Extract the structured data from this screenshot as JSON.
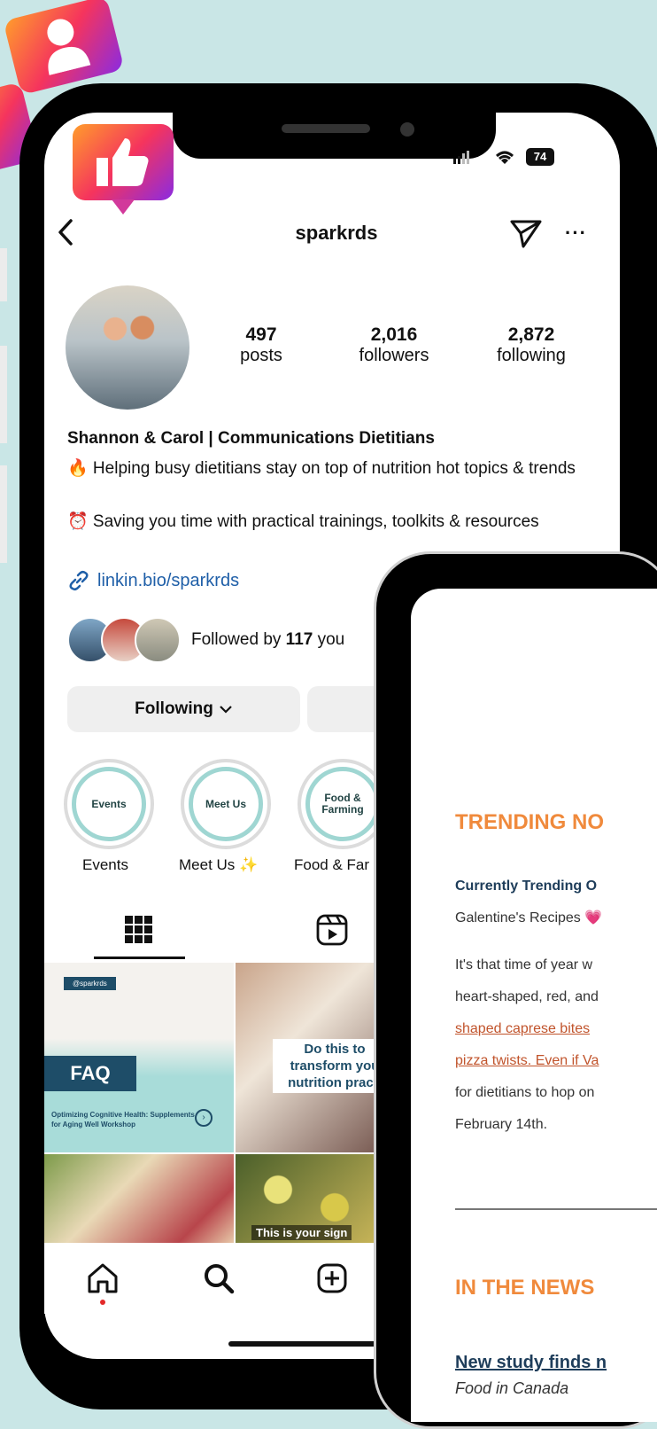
{
  "badges": {
    "user": "user-icon",
    "like": "thumbs-up-icon"
  },
  "status_bar": {
    "battery": "74"
  },
  "profile": {
    "username": "sparkrds",
    "posts": {
      "count": "497",
      "label": "posts"
    },
    "followers": {
      "count": "2,016",
      "label": "followers"
    },
    "following": {
      "count": "2,872",
      "label": "following"
    },
    "display_name": "Shannon & Carol | Communications Dietitians",
    "bio_line1": "🔥 Helping busy dietitians stay on top of nutrition hot topics & trends",
    "bio_line2": "⏰ Saving you time with practical trainings, toolkits & resources",
    "link": "linkin.bio/sparkrds",
    "followed_by_prefix": "Followed by ",
    "followed_by_count": "117",
    "followed_by_suffix": " you",
    "following_button": "Following"
  },
  "highlights": [
    {
      "cover": "Events",
      "label": "Events"
    },
    {
      "cover": "Meet Us",
      "label": "Meet Us ✨"
    },
    {
      "cover": "Food & Farming",
      "label": "Food & Far"
    }
  ],
  "posts_grid": {
    "tile1": {
      "handle": "@sparkrds",
      "heading": "FAQ",
      "subtitle": "Optimizing Cognitive Health: Supplements for Aging Well Workshop"
    },
    "tile2": {
      "caption": "Do this to transform you nutrition practi"
    },
    "tile4": {
      "caption": "This is your sign"
    }
  },
  "newsletter": {
    "trending_heading": "TRENDING NO",
    "currently_trending": "Currently Trending O",
    "galentines": "Galentine's Recipes 💗",
    "para_lines": [
      "It's that time of year w",
      "heart-shaped, red, and",
      "shaped caprese bites",
      "pizza twists. Even if Va",
      "for dietitians to hop on",
      "February 14th."
    ],
    "news_heading": "IN THE NEWS",
    "study_title": "New study finds n",
    "study_source": "Food in Canada"
  }
}
